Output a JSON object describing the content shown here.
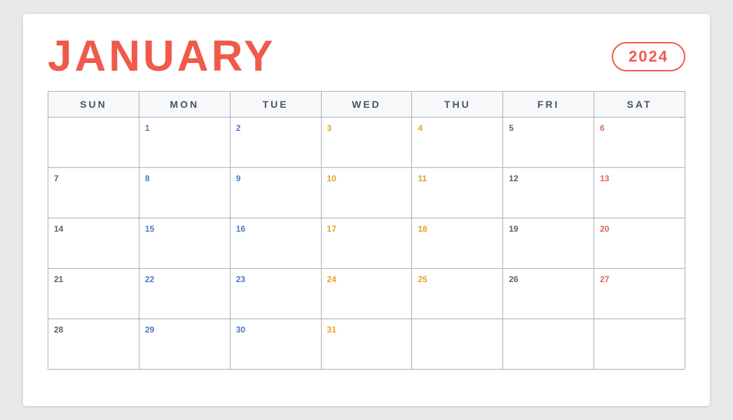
{
  "calendar": {
    "month": "JANUARY",
    "year": "2024",
    "days_header": [
      "SUN",
      "MON",
      "TUE",
      "WED",
      "THU",
      "FRI",
      "SAT"
    ],
    "weeks": [
      [
        {
          "day": "",
          "col": "sun"
        },
        {
          "day": "1",
          "col": "mon"
        },
        {
          "day": "2",
          "col": "tue"
        },
        {
          "day": "3",
          "col": "wed"
        },
        {
          "day": "4",
          "col": "thu"
        },
        {
          "day": "5",
          "col": "fri"
        },
        {
          "day": "6",
          "col": "sat"
        }
      ],
      [
        {
          "day": "7",
          "col": "sun"
        },
        {
          "day": "8",
          "col": "mon"
        },
        {
          "day": "9",
          "col": "tue"
        },
        {
          "day": "10",
          "col": "wed"
        },
        {
          "day": "11",
          "col": "thu"
        },
        {
          "day": "12",
          "col": "fri"
        },
        {
          "day": "13",
          "col": "sat"
        }
      ],
      [
        {
          "day": "14",
          "col": "sun"
        },
        {
          "day": "15",
          "col": "mon"
        },
        {
          "day": "16",
          "col": "tue"
        },
        {
          "day": "17",
          "col": "wed"
        },
        {
          "day": "18",
          "col": "thu"
        },
        {
          "day": "19",
          "col": "fri"
        },
        {
          "day": "20",
          "col": "sat"
        }
      ],
      [
        {
          "day": "21",
          "col": "sun"
        },
        {
          "day": "22",
          "col": "mon"
        },
        {
          "day": "23",
          "col": "tue"
        },
        {
          "day": "24",
          "col": "wed"
        },
        {
          "day": "25",
          "col": "thu"
        },
        {
          "day": "26",
          "col": "fri"
        },
        {
          "day": "27",
          "col": "sat"
        }
      ],
      [
        {
          "day": "28",
          "col": "sun"
        },
        {
          "day": "29",
          "col": "mon"
        },
        {
          "day": "30",
          "col": "tue"
        },
        {
          "day": "31",
          "col": "wed"
        },
        {
          "day": "",
          "col": "thu"
        },
        {
          "day": "",
          "col": "fri"
        },
        {
          "day": "",
          "col": "sat"
        }
      ]
    ]
  }
}
